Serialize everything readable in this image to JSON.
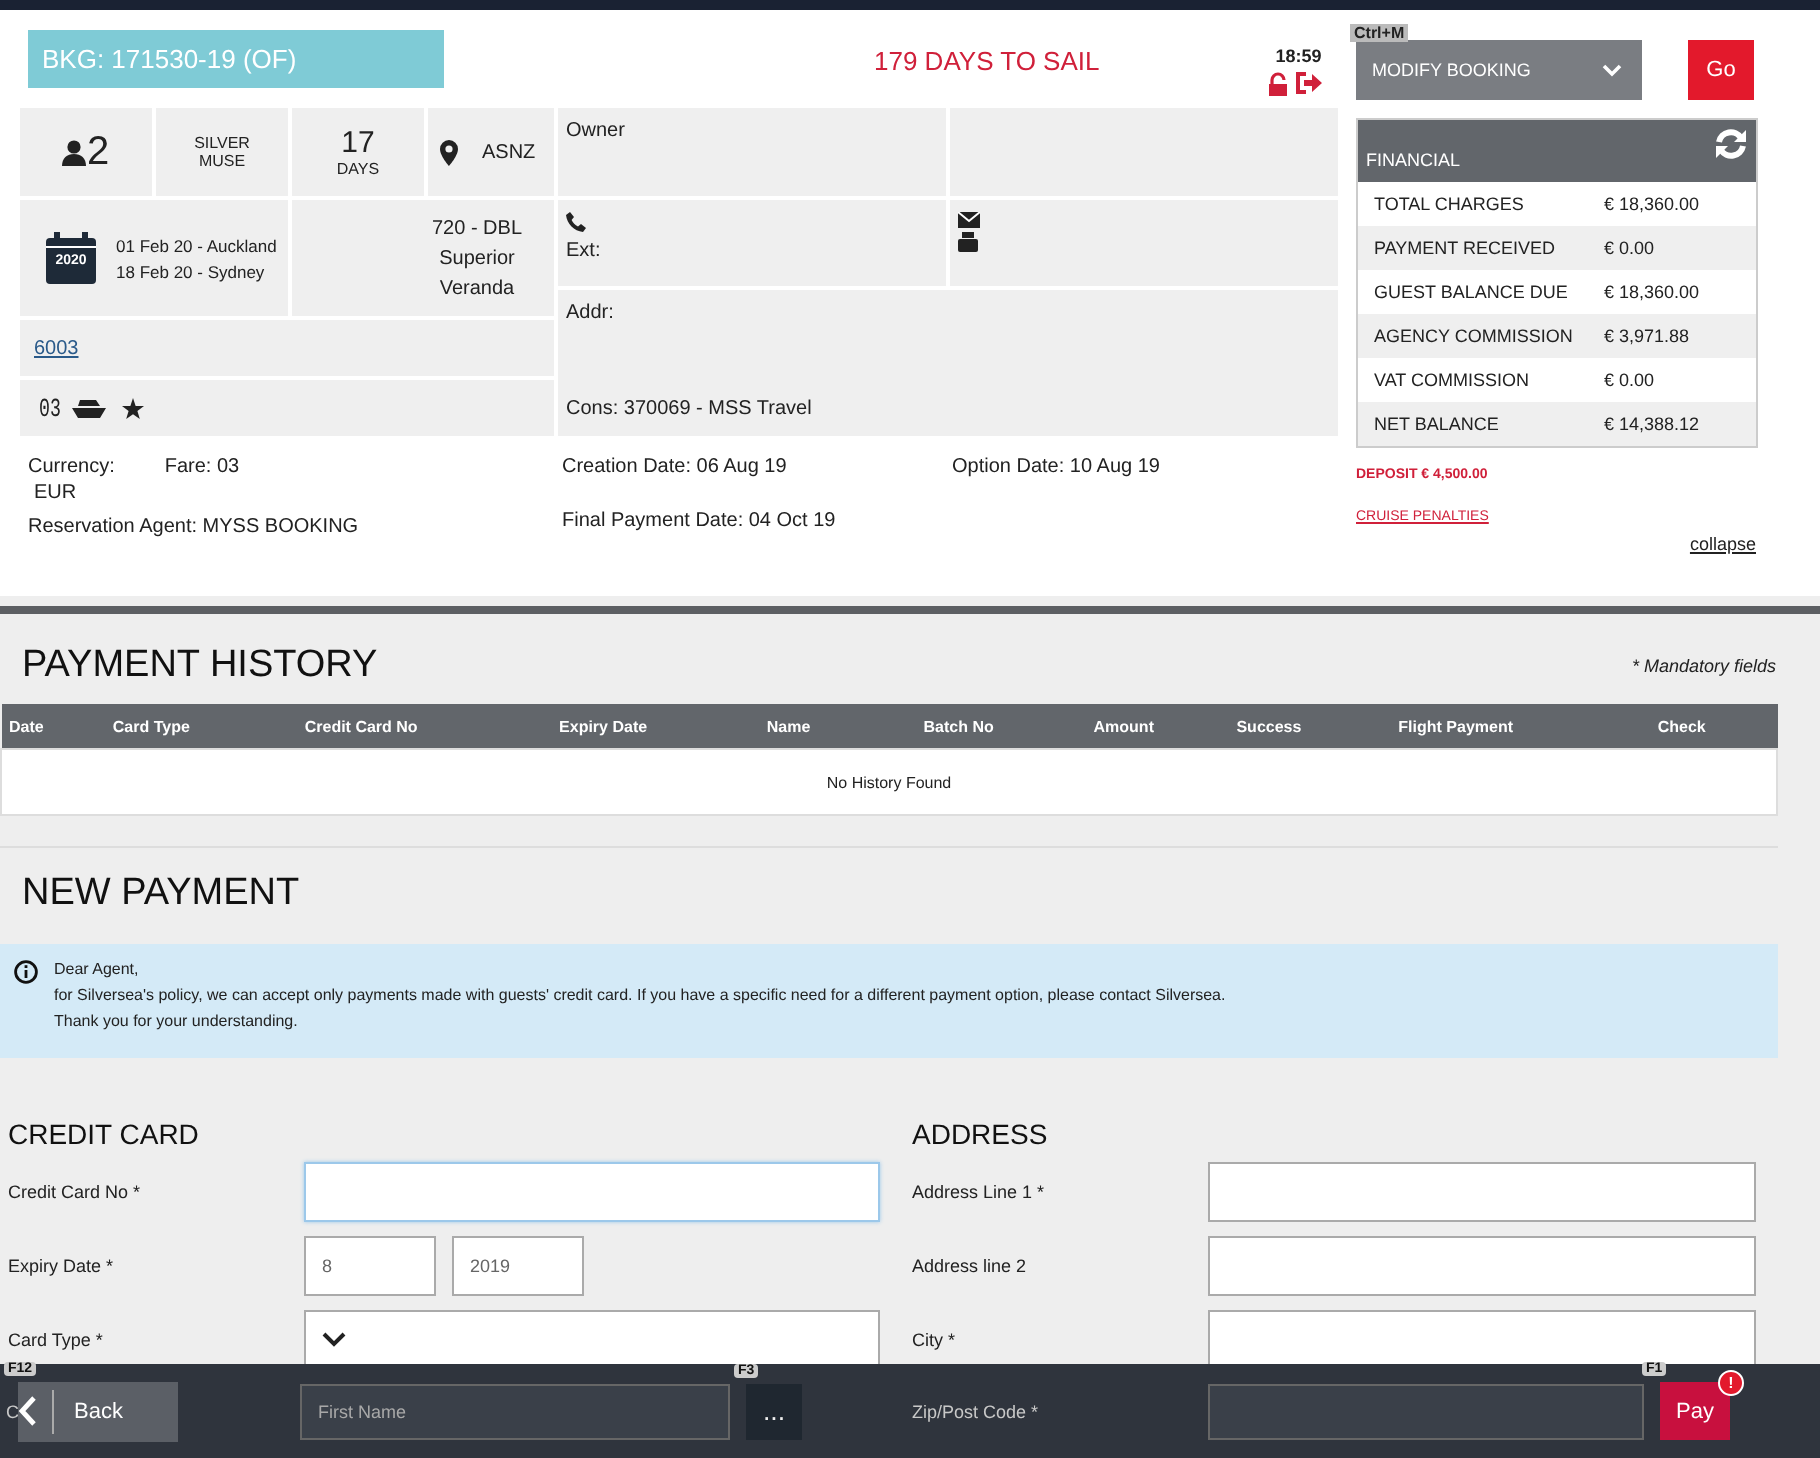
{
  "header": {
    "booking": "BKG: 171530-19 (OF)",
    "countdown": "179 DAYS TO SAIL",
    "time": "18:59"
  },
  "summary": {
    "guests": "2",
    "ship": "SILVER MUSE",
    "days_count": "17",
    "days_label": "DAYS",
    "region": "ASNZ",
    "calendar_year": "2020",
    "dates": [
      "01 Feb 20 - Auckland",
      "18 Feb 20 - Sydney"
    ],
    "cabin": "720 - DBL Superior Veranda",
    "cabin_link": "6003",
    "code": "03"
  },
  "contact": {
    "owner_label": "Owner",
    "ext_label": "Ext:",
    "addr_label": "Addr:",
    "consortium": "Cons: 370069 - MSS Travel"
  },
  "details": {
    "currency_label": "Currency:",
    "fare": "Fare: 03",
    "currency": "EUR",
    "agent": "Reservation Agent: MYSS BOOKING",
    "creation": "Creation Date: 06 Aug 19",
    "final_payment": "Final Payment Date: 04 Oct 19",
    "option": "Option Date: 10 Aug 19"
  },
  "actions": {
    "shortcut": "Ctrl+M",
    "dropdown": "MODIFY BOOKING",
    "go": "Go"
  },
  "financial": {
    "title": "FINANCIAL",
    "rows": [
      {
        "label": "TOTAL CHARGES",
        "value": "€ 18,360.00"
      },
      {
        "label": "PAYMENT RECEIVED",
        "value": "€ 0.00"
      },
      {
        "label": "GUEST BALANCE DUE",
        "value": "€ 18,360.00"
      },
      {
        "label": "AGENCY COMMISSION",
        "value": "€ 3,971.88"
      },
      {
        "label": "VAT COMMISSION",
        "value": "€ 0.00"
      },
      {
        "label": "NET BALANCE",
        "value": "€ 14,388.12"
      }
    ],
    "deposit": "DEPOSIT € 4,500.00",
    "penalties": "CRUISE PENALTIES",
    "collapse": "collapse"
  },
  "history": {
    "title": "PAYMENT HISTORY",
    "mandatory": "* Mandatory fields",
    "columns": [
      "Date",
      "Card Type",
      "Credit Card No",
      "Expiry Date",
      "Name",
      "Batch No",
      "Amount",
      "Success",
      "Flight Payment",
      "Check"
    ],
    "empty": "No History Found"
  },
  "new_payment": {
    "title": "NEW PAYMENT",
    "notice": [
      "Dear Agent,",
      "for Silversea's policy, we can accept only payments made with guests' credit card. If you have a specific need for a different payment option, please contact Silversea.",
      "Thank you for your understanding."
    ]
  },
  "credit_card": {
    "title": "CREDIT CARD",
    "fields": [
      {
        "kind": "text",
        "label": "Credit Card No *",
        "focused": true
      },
      {
        "kind": "expiry",
        "label": "Expiry Date *",
        "values": [
          "8",
          "2019"
        ],
        "focused": false
      },
      {
        "kind": "select",
        "label": "Card Type *",
        "focused": false
      }
    ]
  },
  "address": {
    "title": "ADDRESS",
    "fields": [
      {
        "kind": "text",
        "label": "Address Line 1 *",
        "focused": false
      },
      {
        "kind": "text",
        "label": "Address line 2",
        "focused": false
      },
      {
        "kind": "text",
        "label": "City *",
        "focused": false
      }
    ]
  },
  "footer": {
    "back": {
      "label": "Back",
      "shortcut": "F12"
    },
    "name_field": {
      "label": "C",
      "placeholder": "First Name",
      "button": "...",
      "shortcut": "F3",
      "focused": false
    },
    "zip_field": {
      "label": "Zip/Post Code *",
      "focused": false
    },
    "pay": {
      "label": "Pay",
      "shortcut": "F1",
      "alert": "!"
    }
  }
}
